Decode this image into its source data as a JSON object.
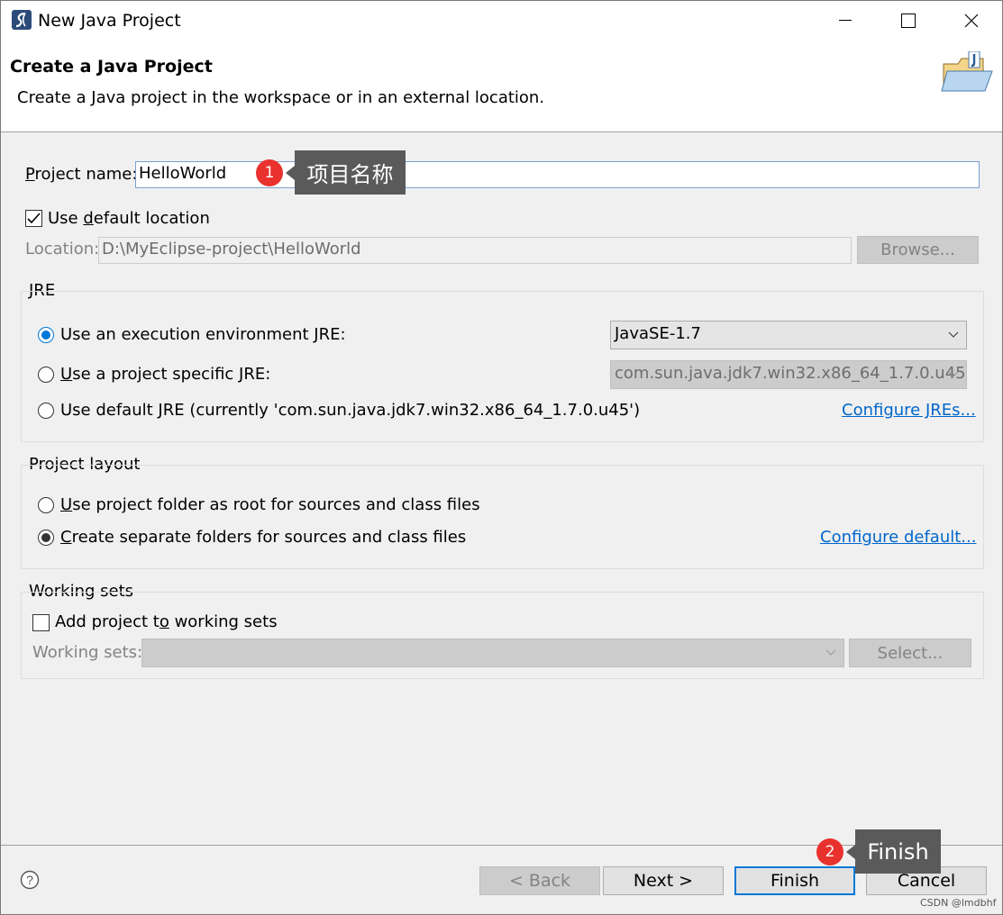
{
  "window": {
    "title": "New Java Project"
  },
  "header": {
    "title": "Create a Java Project",
    "description": "Create a Java project in the workspace or in an external location."
  },
  "project_name": {
    "label": "Project name:",
    "value": "HelloWorld"
  },
  "use_default_location": {
    "label": "Use default location",
    "checked": true
  },
  "location": {
    "label": "Location:",
    "value": "D:\\MyEclipse-project\\HelloWorld",
    "browse_label": "Browse..."
  },
  "jre": {
    "title": "JRE",
    "option_exec_env": "Use an execution environment JRE:",
    "exec_env_value": "JavaSE-1.7",
    "option_project_specific": "Use a project specific JRE:",
    "project_specific_value": "com.sun.java.jdk7.win32.x86_64_1.7.0.u45",
    "option_default": "Use default JRE (currently 'com.sun.java.jdk7.win32.x86_64_1.7.0.u45')",
    "configure_link": "Configure JREs...",
    "selected": "exec_env"
  },
  "layout": {
    "title": "Project layout",
    "option_root": "Use project folder as root for sources and class files",
    "option_separate": "Create separate folders for sources and class files",
    "configure_link": "Configure default...",
    "selected": "separate"
  },
  "working_sets": {
    "title": "Working sets",
    "add_label": "Add project to working sets",
    "checked": false,
    "sets_label": "Working sets:",
    "select_label": "Select..."
  },
  "buttons": {
    "back": "< Back",
    "next": "Next >",
    "finish": "Finish",
    "cancel": "Cancel"
  },
  "annotations": {
    "badge1": "1",
    "callout1": "项目名称",
    "badge2": "2",
    "callout2": "Finish"
  },
  "watermark": "CSDN @lmdbhf",
  "colors": {
    "accent": "#0078d7",
    "link": "#0066cc",
    "badge": "#e9322e",
    "callout": "#5a5a5a"
  }
}
